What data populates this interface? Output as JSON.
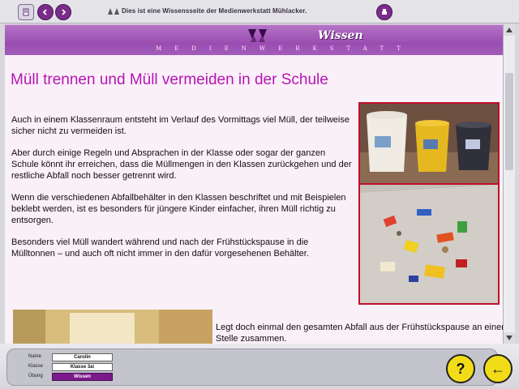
{
  "topbar": {
    "message": "Dies ist eine Wissensseite der Medienwerkstatt Mühlacker.",
    "icons": [
      "page-icon",
      "back-arrow-icon",
      "forward-arrow-icon",
      "print-icon"
    ]
  },
  "header": {
    "wissen": "Wissen",
    "brand": "MEDIENWERKSTATT"
  },
  "content": {
    "title": "Müll trennen und Müll vermeiden in der Schule",
    "paragraphs": [
      "Auch in einem Klassenraum entsteht im Verlauf des Vormittags viel Müll, der teilweise sicher nicht zu vermeiden ist.",
      "Aber durch einige Regeln und Absprachen in der Klasse oder sogar der ganzen Schule könnt ihr erreichen, dass die Müllmengen in den Klassen zurückgehen und der restliche Abfall noch besser getrennt wird.",
      "Wenn die verschiedenen Abfallbehälter in den Klassen beschriftet und mit Beispielen beklebt werden, ist es besonders für jüngere Kinder einfacher, ihren Müll richtig zu entsorgen.",
      "Besonders viel Müll wandert während und nach der Frühstückspause in die Mülltonnen – und auch oft nicht immer in den dafür vorgesehenen Behälter."
    ],
    "bottom_text": "Legt doch einmal den gesamten Abfall aus der Frühstückspause an einer Stelle zusammen."
  },
  "footer": {
    "name_label": "Name",
    "name_value": "Carolin",
    "class_label": "Klasse",
    "class_value": "Klasse 3a\\",
    "exercise_label": "Übung",
    "exercise_value": "Wissen",
    "help_label": "?",
    "back_label": "←"
  },
  "colors": {
    "accent": "#9a4cb0",
    "title": "#b416b4",
    "photo_border": "#c0102a",
    "button_yellow": "#f2dc18"
  }
}
